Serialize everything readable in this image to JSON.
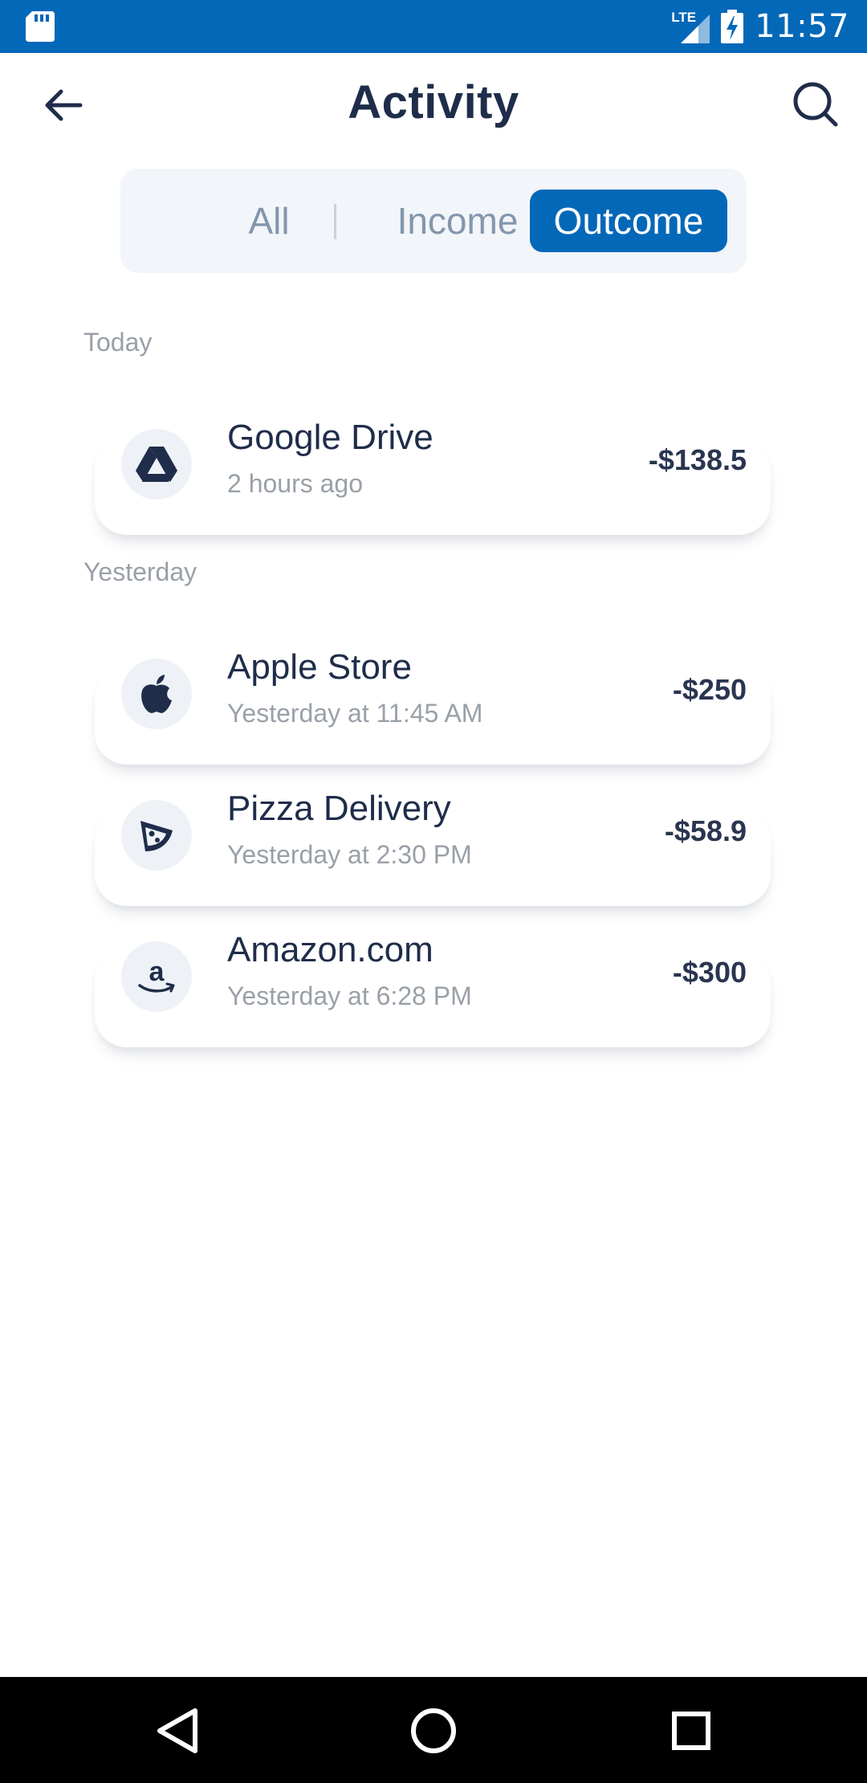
{
  "status_bar": {
    "time": "11:57",
    "network": "LTE"
  },
  "header": {
    "title": "Activity"
  },
  "tabs": [
    {
      "label": "All",
      "active": false
    },
    {
      "label": "Income",
      "active": false
    },
    {
      "label": "Outcome",
      "active": true
    }
  ],
  "sections": [
    {
      "label": "Today",
      "items": [
        {
          "name": "Google Drive",
          "time": "2 hours ago",
          "amount": "-$138.5",
          "icon": "google-drive-icon"
        }
      ]
    },
    {
      "label": "Yesterday",
      "items": [
        {
          "name": "Apple Store",
          "time": "Yesterday at 11:45 AM",
          "amount": "-$250",
          "icon": "apple-icon"
        },
        {
          "name": "Pizza Delivery",
          "time": "Yesterday at 2:30 PM",
          "amount": "-$58.9",
          "icon": "pizza-icon"
        },
        {
          "name": "Amazon.com",
          "time": "Yesterday at 6:28 PM",
          "amount": "-$300",
          "icon": "amazon-icon"
        }
      ]
    }
  ],
  "colors": {
    "accent": "#0468b8",
    "text": "#1f2d4a",
    "muted": "#9aa0a8",
    "tab_inactive": "#8396ad"
  }
}
